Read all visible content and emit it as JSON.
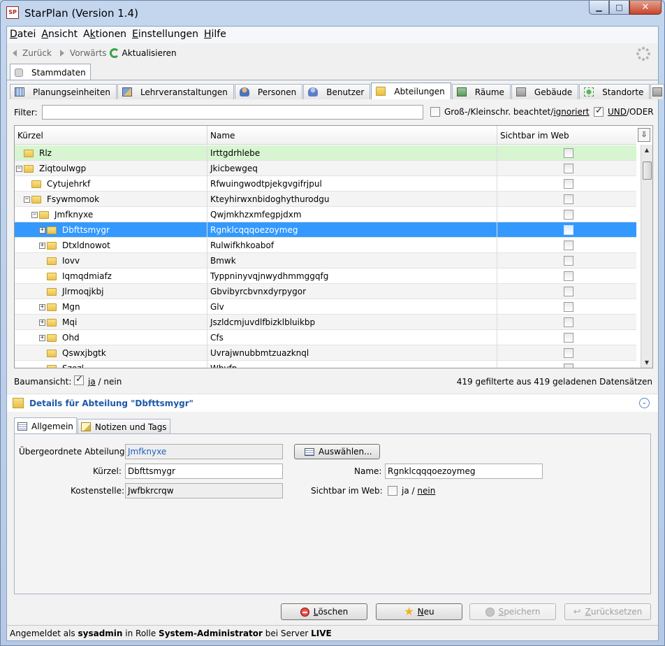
{
  "window": {
    "title": "StarPlan (Version 1.4)",
    "app_icon": "SP"
  },
  "menu": {
    "items": [
      {
        "label": "Datei",
        "mnemonic": "D",
        "rest": "atei"
      },
      {
        "label": "Ansicht",
        "mnemonic": "A",
        "rest": "nsicht"
      },
      {
        "label": "Aktionen",
        "pre": "A",
        "mnemonic": "k",
        "rest": "tionen"
      },
      {
        "label": "Einstellungen",
        "mnemonic": "E",
        "rest": "instellungen"
      },
      {
        "label": "Hilfe",
        "mnemonic": "H",
        "rest": "ilfe"
      }
    ]
  },
  "nav": {
    "back": "Zurück",
    "forward": "Vorwärts",
    "refresh": "Aktualisieren"
  },
  "main_tab": "Stammdaten",
  "subtabs": [
    {
      "label": "Planungseinheiten",
      "icon": "grid-icon"
    },
    {
      "label": "Lehrveranstaltungen",
      "icon": "lecture-icon"
    },
    {
      "label": "Personen",
      "icon": "person-icon"
    },
    {
      "label": "Benutzer",
      "icon": "user-icon"
    },
    {
      "label": "Abteilungen",
      "icon": "folder-icon",
      "active": true
    },
    {
      "label": "Räume",
      "icon": "room-icon"
    },
    {
      "label": "Gebäude",
      "icon": "building-icon"
    },
    {
      "label": "Standorte",
      "icon": "location-icon"
    }
  ],
  "filter": {
    "label": "Filter:",
    "value": "",
    "case_label_a": "Groß-/Kleinschr. beachtet/",
    "case_label_b": "ignoriert",
    "und_label": "UND",
    "oder_label": "/ODER"
  },
  "table": {
    "columns": [
      "Kürzel",
      "Name",
      "Sichtbar im Web"
    ],
    "rows": [
      {
        "indent": 0,
        "expander": "",
        "kuerzel": "Rlz",
        "name": "Irttgdrhlebe",
        "style": "first"
      },
      {
        "indent": 0,
        "expander": "−",
        "kuerzel": "Ziqtoulwgp",
        "name": "Jkicbewgeq",
        "style": "alt"
      },
      {
        "indent": 1,
        "expander": "",
        "kuerzel": "Cytujehrkf",
        "name": "Rfwuingwodtpjekgvgifrjpul",
        "style": ""
      },
      {
        "indent": 1,
        "expander": "−",
        "kuerzel": "Fsywmomok",
        "name": "Kteyhirwxnbidoghythurodgu",
        "style": "alt"
      },
      {
        "indent": 2,
        "expander": "−",
        "kuerzel": "Jmfknyxe",
        "name": "Qwjmkhzxmfegpjdxm",
        "style": ""
      },
      {
        "indent": 3,
        "expander": "+",
        "kuerzel": "Dbfttsmygr",
        "name": "Rgnklcqqqoezoymeg",
        "style": "sel"
      },
      {
        "indent": 3,
        "expander": "+",
        "kuerzel": "Dtxldnowot",
        "name": "Rulwifkhkoabof",
        "style": ""
      },
      {
        "indent": 3,
        "expander": "",
        "kuerzel": "Iovv",
        "name": "Bmwk",
        "style": "alt"
      },
      {
        "indent": 3,
        "expander": "",
        "kuerzel": "Iqmqdmiafz",
        "name": "Typpninyvqjnwydhmmggqfg",
        "style": ""
      },
      {
        "indent": 3,
        "expander": "",
        "kuerzel": "Jlrmoqjkbj",
        "name": "Gbvibyrcbvnxdyrpygor",
        "style": "alt"
      },
      {
        "indent": 3,
        "expander": "+",
        "kuerzel": "Mgn",
        "name": "Glv",
        "style": ""
      },
      {
        "indent": 3,
        "expander": "+",
        "kuerzel": "Mqi",
        "name": "Jszldcmjuvdlfbizklbluikbp",
        "style": "alt"
      },
      {
        "indent": 3,
        "expander": "+",
        "kuerzel": "Ohd",
        "name": "Cfs",
        "style": ""
      },
      {
        "indent": 3,
        "expander": "",
        "kuerzel": "Qswxjbgtk",
        "name": "Uvrajwnubbmtzuazknql",
        "style": "alt"
      },
      {
        "indent": 3,
        "expander": "",
        "kuerzel": "Szezl",
        "name": "Wbyfp",
        "style": ""
      }
    ]
  },
  "tree_view": {
    "label": "Baumansicht:",
    "ja": "ja",
    "nein": "/ nein",
    "checked": true
  },
  "count_text": "419 gefilterte aus 419 geladenen Datensätzen",
  "details": {
    "title": "Details für Abteilung \"Dbfttsmygr\"",
    "tabs": [
      "Allgemein",
      "Notizen und Tags"
    ],
    "parent_label": "Übergeordnete Abteilung:",
    "parent_value": "Jmfknyxe",
    "pick_button": "Auswählen...",
    "kuerzel_label": "Kürzel:",
    "kuerzel_value": "Dbfttsmygr",
    "name_label": "Name:",
    "name_value": "Rgnklcqqqoezoymeg",
    "kosten_label": "Kostenstelle:",
    "kosten_value": "Jwfbkrcrqw",
    "web_label": "Sichtbar im Web:",
    "web_ja": "ja /",
    "web_nein": "nein"
  },
  "buttons": {
    "delete": {
      "pre": "",
      "mnemonic": "L",
      "rest": "öschen"
    },
    "new": {
      "pre": "",
      "mnemonic": "N",
      "rest": "eu"
    },
    "save": {
      "pre": "",
      "mnemonic": "S",
      "rest": "peichern"
    },
    "reset": {
      "pre": "",
      "mnemonic": "Z",
      "rest": "urücksetzen"
    }
  },
  "status": {
    "prefix": "Angemeldet als ",
    "user": "sysadmin",
    "mid": " in Rolle ",
    "role": "System-Administrator",
    "mid2": " bei Server ",
    "server": "LIVE"
  }
}
